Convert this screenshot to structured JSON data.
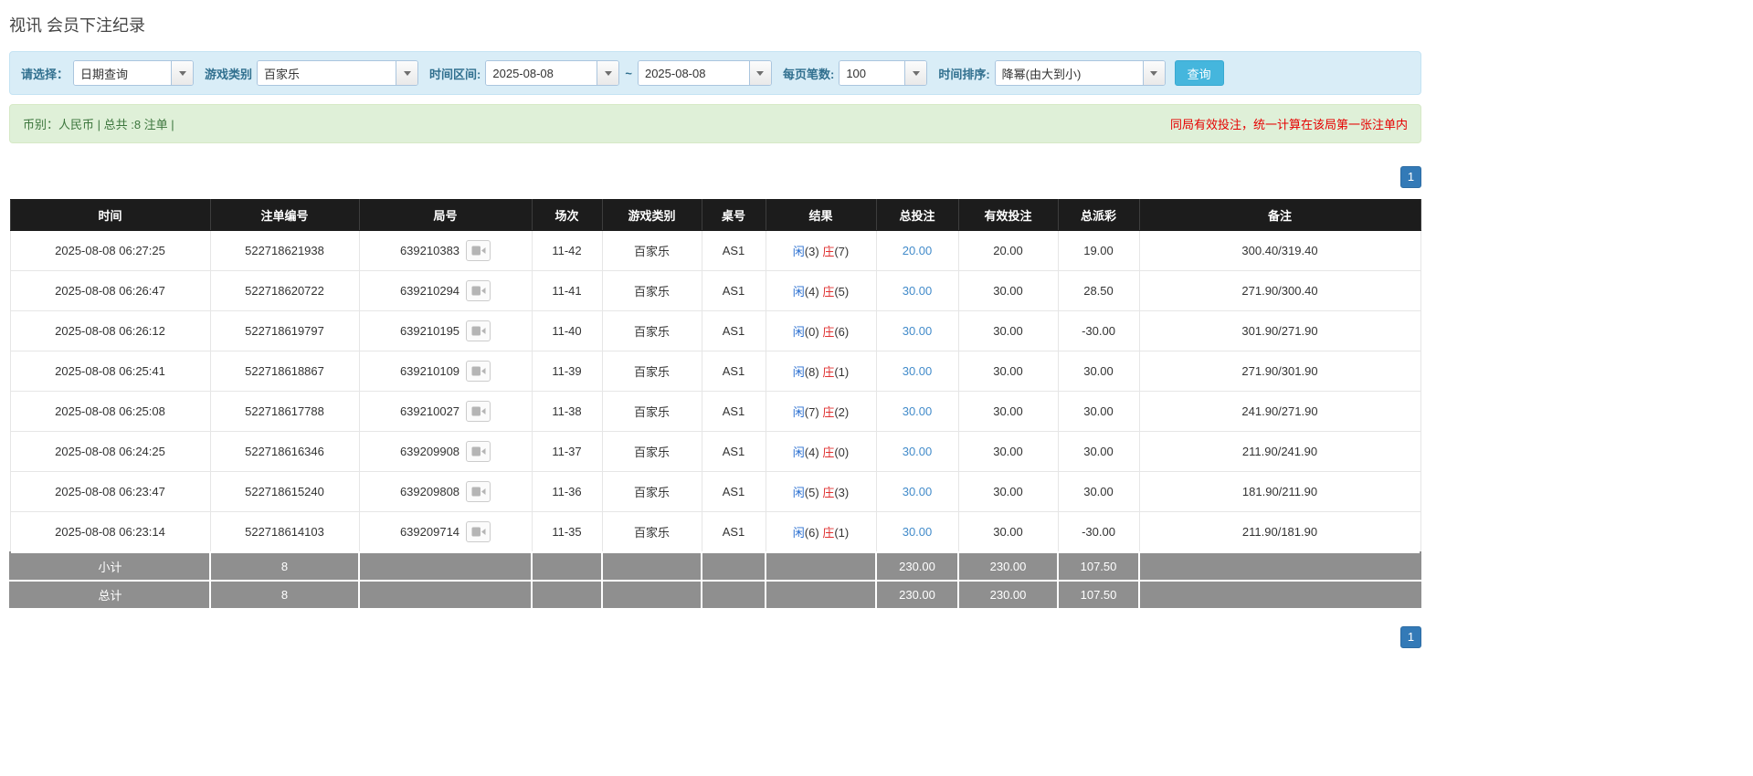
{
  "page": {
    "title": "视讯 会员下注纪录"
  },
  "filters": {
    "select_label": "请选择：",
    "select_value": "日期查询",
    "game_type_label": "游戏类别",
    "game_type_value": "百家乐",
    "date_range_label": "时间区间:",
    "date_from": "2025-08-08",
    "date_separator": "~",
    "date_to": "2025-08-08",
    "page_size_label": "每页笔数:",
    "page_size_value": "100",
    "sort_label": "时间排序:",
    "sort_value": "降幂(由大到小)",
    "search_button": "查询"
  },
  "info_bar": {
    "left": "币别：人民币 | 总共 :8 注单 |",
    "right": "同局有效投注，统一计算在该局第一张注单内"
  },
  "pagination": {
    "page": "1"
  },
  "table": {
    "headers": [
      "时间",
      "注单编号",
      "局号",
      "场次",
      "游戏类别",
      "桌号",
      "结果",
      "总投注",
      "有效投注",
      "总派彩",
      "备注"
    ],
    "rows": [
      {
        "time": "2025-08-08 06:27:25",
        "bet_id": "522718621938",
        "round_id": "639210383",
        "session": "11-42",
        "game_type": "百家乐",
        "table_no": "AS1",
        "player": "闲",
        "player_n": "(3)",
        "banker": "庄",
        "banker_n": "(7)",
        "total_bet": "20.00",
        "valid_bet": "20.00",
        "payout": "19.00",
        "remark": "300.40/319.40"
      },
      {
        "time": "2025-08-08 06:26:47",
        "bet_id": "522718620722",
        "round_id": "639210294",
        "session": "11-41",
        "game_type": "百家乐",
        "table_no": "AS1",
        "player": "闲",
        "player_n": "(4)",
        "banker": "庄",
        "banker_n": "(5)",
        "total_bet": "30.00",
        "valid_bet": "30.00",
        "payout": "28.50",
        "remark": "271.90/300.40"
      },
      {
        "time": "2025-08-08 06:26:12",
        "bet_id": "522718619797",
        "round_id": "639210195",
        "session": "11-40",
        "game_type": "百家乐",
        "table_no": "AS1",
        "player": "闲",
        "player_n": "(0)",
        "banker": "庄",
        "banker_n": "(6)",
        "total_bet": "30.00",
        "valid_bet": "30.00",
        "payout": "-30.00",
        "remark": "301.90/271.90"
      },
      {
        "time": "2025-08-08 06:25:41",
        "bet_id": "522718618867",
        "round_id": "639210109",
        "session": "11-39",
        "game_type": "百家乐",
        "table_no": "AS1",
        "player": "闲",
        "player_n": "(8)",
        "banker": "庄",
        "banker_n": "(1)",
        "total_bet": "30.00",
        "valid_bet": "30.00",
        "payout": "30.00",
        "remark": "271.90/301.90"
      },
      {
        "time": "2025-08-08 06:25:08",
        "bet_id": "522718617788",
        "round_id": "639210027",
        "session": "11-38",
        "game_type": "百家乐",
        "table_no": "AS1",
        "player": "闲",
        "player_n": "(7)",
        "banker": "庄",
        "banker_n": "(2)",
        "total_bet": "30.00",
        "valid_bet": "30.00",
        "payout": "30.00",
        "remark": "241.90/271.90"
      },
      {
        "time": "2025-08-08 06:24:25",
        "bet_id": "522718616346",
        "round_id": "639209908",
        "session": "11-37",
        "game_type": "百家乐",
        "table_no": "AS1",
        "player": "闲",
        "player_n": "(4)",
        "banker": "庄",
        "banker_n": "(0)",
        "total_bet": "30.00",
        "valid_bet": "30.00",
        "payout": "30.00",
        "remark": "211.90/241.90"
      },
      {
        "time": "2025-08-08 06:23:47",
        "bet_id": "522718615240",
        "round_id": "639209808",
        "session": "11-36",
        "game_type": "百家乐",
        "table_no": "AS1",
        "player": "闲",
        "player_n": "(5)",
        "banker": "庄",
        "banker_n": "(3)",
        "total_bet": "30.00",
        "valid_bet": "30.00",
        "payout": "30.00",
        "remark": "181.90/211.90"
      },
      {
        "time": "2025-08-08 06:23:14",
        "bet_id": "522718614103",
        "round_id": "639209714",
        "session": "11-35",
        "game_type": "百家乐",
        "table_no": "AS1",
        "player": "闲",
        "player_n": "(6)",
        "banker": "庄",
        "banker_n": "(1)",
        "total_bet": "30.00",
        "valid_bet": "30.00",
        "payout": "-30.00",
        "remark": "211.90/181.90"
      }
    ],
    "subtotal": {
      "label": "小计",
      "count": "8",
      "total_bet": "230.00",
      "valid_bet": "230.00",
      "payout": "107.50"
    },
    "total": {
      "label": "总计",
      "count": "8",
      "total_bet": "230.00",
      "valid_bet": "230.00",
      "payout": "107.50"
    }
  }
}
